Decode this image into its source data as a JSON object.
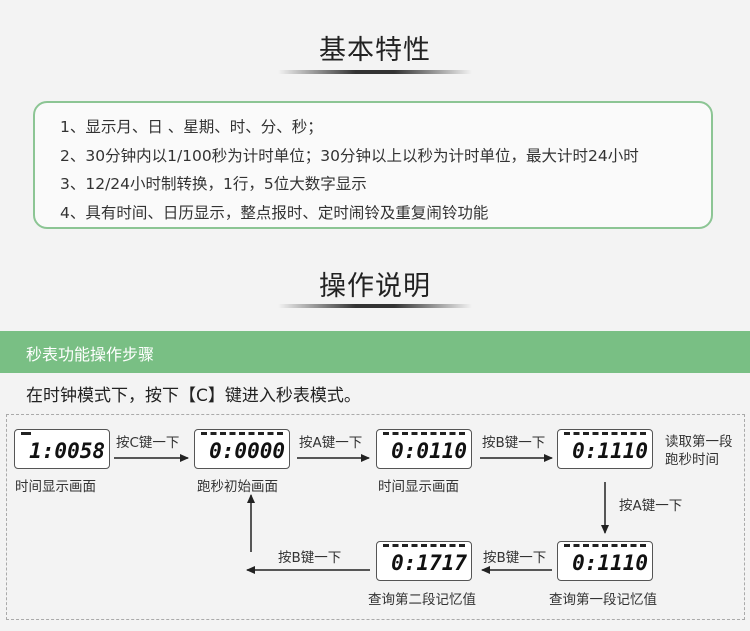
{
  "headings": {
    "features_title": "基本特性",
    "operation_title": "操作说明"
  },
  "features": [
    "1、显示月、日 、星期、时、分、秒；",
    "2、30分钟内以1/100秒为计时单位；30分钟以上以秒为计时单位，最大计时24小时",
    "3、12/24小时制转换，1行，5位大数字显示",
    "4、具有时间、日历显示，整点报时、定时闹铃及重复闹铃功能"
  ],
  "section_bar": "秒表功能操作步骤",
  "intro": "在时钟模式下，按下【C】键进入秒表模式。",
  "displays": [
    {
      "digits": "1:0058",
      "caption": "时间显示画面"
    },
    {
      "digits": "0:0000",
      "caption": "跑秒初始画面"
    },
    {
      "digits": "0:0110",
      "caption": "时间显示画面"
    },
    {
      "digits": "0:1110",
      "caption": "读取第一段跑秒时间"
    },
    {
      "digits": "0:1110",
      "caption": "查询第一段记忆值"
    },
    {
      "digits": "0:1717",
      "caption": "查询第二段记忆值"
    }
  ],
  "arrow_labels": {
    "press_c": "按C键一下",
    "press_a_1": "按A键一下",
    "press_b_1": "按B键一下",
    "press_a_2": "按A键一下",
    "press_b_2": "按B键一下",
    "press_b_3": "按B键一下"
  },
  "colors": {
    "accent_green": "#79bf84",
    "box_border": "#8cc594"
  }
}
